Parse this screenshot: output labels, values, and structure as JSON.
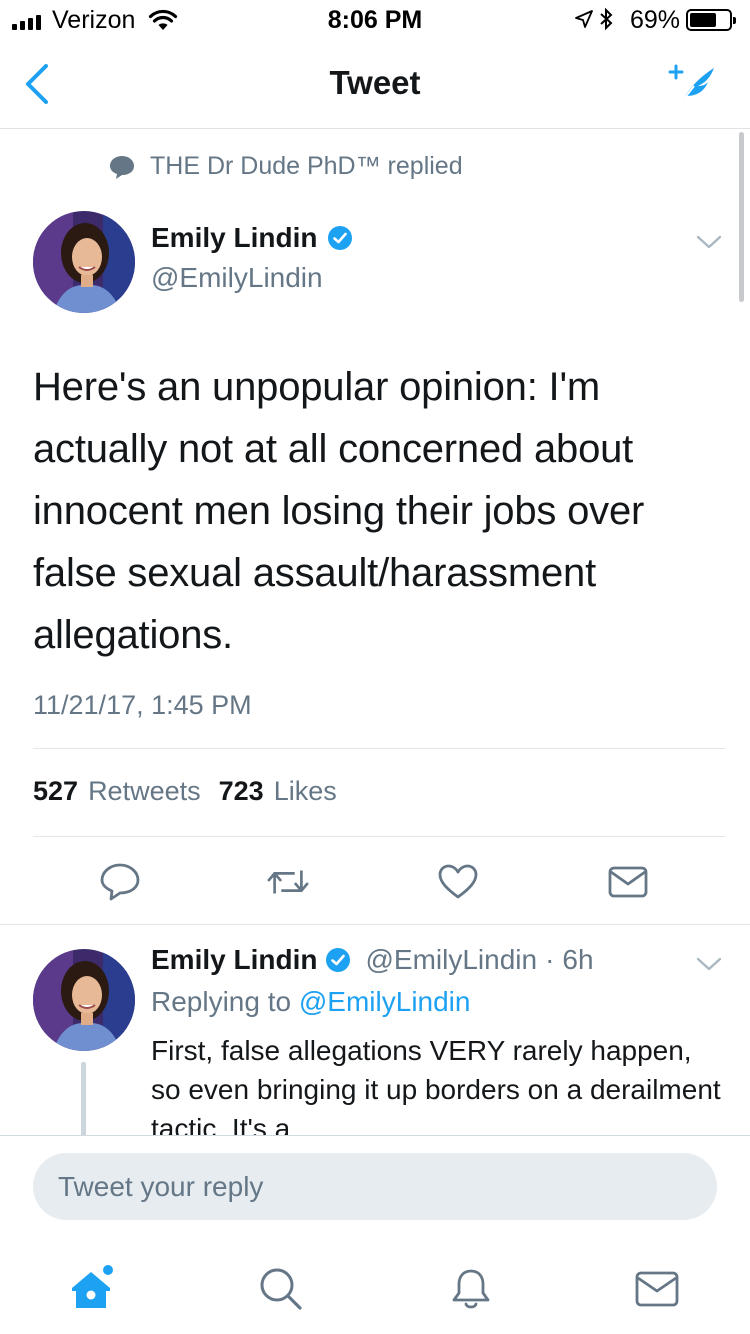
{
  "status_bar": {
    "carrier": "Verizon",
    "time": "8:06 PM",
    "battery_percent": "69%",
    "battery_level": 0.69,
    "icons": [
      "signal-icon",
      "wifi-icon",
      "location-arrow-icon",
      "bluetooth-icon",
      "battery-icon"
    ]
  },
  "nav": {
    "title": "Tweet",
    "back_icon": "chevron-left-icon",
    "compose_icon": "compose-tweet-icon"
  },
  "main_tweet": {
    "context": "THE Dr Dude PhD™ replied",
    "author_name": "Emily Lindin",
    "author_handle": "@EmilyLindin",
    "verified": true,
    "text": "Here's an unpopular opinion: I'm actually not at all concerned about innocent men losing their jobs over false sexual assault/harassment allegations.",
    "timestamp": "11/21/17, 1:45 PM",
    "retweets_count": "527",
    "retweets_label": "Retweets",
    "likes_count": "723",
    "likes_label": "Likes",
    "actions": [
      "reply-icon",
      "retweet-icon",
      "like-icon",
      "direct-message-icon"
    ]
  },
  "reply_tweet": {
    "author_name": "Emily Lindin",
    "author_handle": "@EmilyLindin",
    "separator": "·",
    "age": "6h",
    "replying_prefix": "Replying to",
    "replying_to": "@EmilyLindin",
    "text": "First, false allegations VERY rarely happen, so even bringing it up borders on a derailment tactic. It's a"
  },
  "composer": {
    "placeholder": "Tweet your reply"
  },
  "tab_bar": {
    "items": [
      "home-icon",
      "search-icon",
      "notifications-icon",
      "messages-icon"
    ],
    "active": "home-icon",
    "active_color": "#1da1f2",
    "inactive_color": "#657786"
  },
  "colors": {
    "accent": "#1da1f2",
    "text_primary": "#14171a",
    "text_secondary": "#657786",
    "divider": "#e1e8ed"
  }
}
